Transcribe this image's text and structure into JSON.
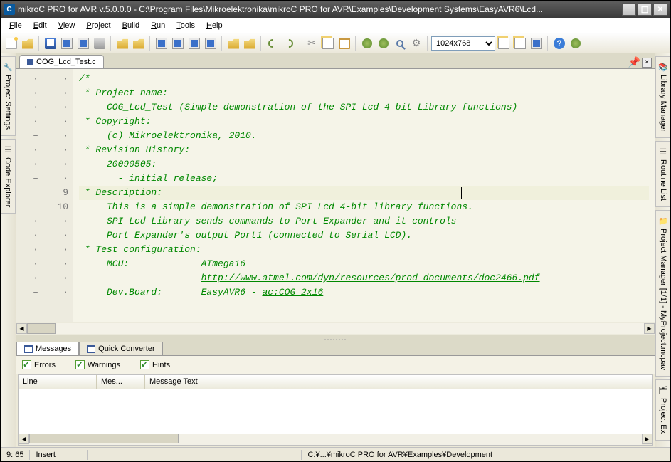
{
  "titlebar": {
    "app_icon": "C",
    "text": "mikroC PRO for AVR v.5.0.0.0 - C:\\Program Files\\Mikroelektronika\\mikroC PRO for AVR\\Examples\\Development Systems\\EasyAVR6\\Lcd..."
  },
  "menu": [
    "File",
    "Edit",
    "View",
    "Project",
    "Build",
    "Run",
    "Tools",
    "Help"
  ],
  "resolution_select": "1024x768",
  "file_tab": "COG_Lcd_Test.c",
  "left_tabs": [
    "Project Settings",
    "Code Explorer"
  ],
  "right_tabs": [
    "Library Manager",
    "Routine List",
    "Project Manager [1/1] - MyProject.mcpav",
    "Project Ex"
  ],
  "gutter": [
    {
      "mark": "·",
      "num": "·"
    },
    {
      "mark": "·",
      "num": "·"
    },
    {
      "mark": "·",
      "num": "·"
    },
    {
      "mark": "·",
      "num": "·"
    },
    {
      "mark": "–",
      "num": "·"
    },
    {
      "mark": "·",
      "num": "·"
    },
    {
      "mark": "·",
      "num": "·"
    },
    {
      "mark": "–",
      "num": "·"
    },
    {
      "mark": "",
      "num": "9"
    },
    {
      "mark": "",
      "num": "10"
    },
    {
      "mark": "·",
      "num": "·"
    },
    {
      "mark": "·",
      "num": "·"
    },
    {
      "mark": "·",
      "num": "·"
    },
    {
      "mark": "·",
      "num": "·"
    },
    {
      "mark": "·",
      "num": "·"
    },
    {
      "mark": "–",
      "num": "·"
    }
  ],
  "code": {
    "l1": "/*",
    "l2": " * Project name:",
    "l3": "     COG_Lcd_Test (Simple demonstration of the SPI Lcd 4-bit Library functions)",
    "l4": " * Copyright:",
    "l5": "     (c) Mikroelektronika, 2010.",
    "l6": " * Revision History:",
    "l7": "     20090505:",
    "l8": "       - initial release;",
    "l9": " * Description:",
    "l10": "     This is a simple demonstration of SPI Lcd 4-bit library functions.",
    "l11": "     SPI Lcd Library sends commands to Port Expander and it controls",
    "l12": "     Port Expander's output Port1 (connected to Serial LCD).",
    "l13": " * Test configuration:",
    "l14": "     MCU:             ATmega16",
    "l15": "                      ",
    "l15_url": "http://www.atmel.com/dyn/resources/prod_documents/doc2466.pdf",
    "l16": "     Dev.Board:       EasyAVR6 - ",
    "l16_url": "ac:COG_2x16"
  },
  "bottom_tabs": {
    "messages": "Messages",
    "quick_converter": "Quick Converter"
  },
  "filters": {
    "errors": "Errors",
    "warnings": "Warnings",
    "hints": "Hints"
  },
  "msg_cols": {
    "line": "Line",
    "mes": "Mes...",
    "text": "Message Text"
  },
  "statusbar": {
    "pos": "9: 65",
    "mode": "Insert",
    "path": "C:¥...¥mikroC PRO for AVR¥Examples¥Development"
  }
}
